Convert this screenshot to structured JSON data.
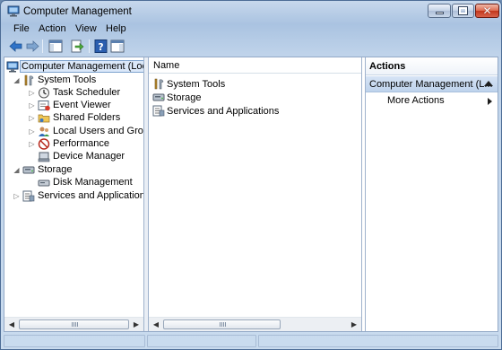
{
  "window": {
    "title": "Computer Management"
  },
  "menu": [
    "File",
    "Action",
    "View",
    "Help"
  ],
  "toolbar": {
    "buttons": [
      "back-icon",
      "forward-icon",
      "show-hide-console-tree-icon",
      "export-list-icon",
      "help-icon",
      "show-hide-action-pane-icon"
    ]
  },
  "tree": {
    "root": "Computer Management (Local",
    "items": [
      {
        "label": "System Tools",
        "icon": "system-tools-icon",
        "level": 1,
        "expander": "expanded"
      },
      {
        "label": "Task Scheduler",
        "icon": "task-scheduler-icon",
        "level": 2,
        "expander": "collapsed"
      },
      {
        "label": "Event Viewer",
        "icon": "event-viewer-icon",
        "level": 2,
        "expander": "collapsed"
      },
      {
        "label": "Shared Folders",
        "icon": "shared-folders-icon",
        "level": 2,
        "expander": "collapsed"
      },
      {
        "label": "Local Users and Groups",
        "icon": "local-users-icon",
        "level": 2,
        "expander": "collapsed"
      },
      {
        "label": "Performance",
        "icon": "performance-icon",
        "level": 2,
        "expander": "collapsed"
      },
      {
        "label": "Device Manager",
        "icon": "device-manager-icon",
        "level": 2,
        "expander": "none"
      },
      {
        "label": "Storage",
        "icon": "storage-icon",
        "level": 1,
        "expander": "expanded"
      },
      {
        "label": "Disk Management",
        "icon": "disk-management-icon",
        "level": 2,
        "expander": "none"
      },
      {
        "label": "Services and Applications",
        "icon": "services-icon",
        "level": 1,
        "expander": "collapsed"
      }
    ]
  },
  "list": {
    "column": "Name",
    "items": [
      "System Tools",
      "Storage",
      "Services and Applications"
    ]
  },
  "actions": {
    "header": "Actions",
    "group": "Computer Management (L...",
    "items": [
      "More Actions"
    ]
  },
  "colors": {
    "selection": "#dbe8f9",
    "window_frame": "#aac3e1",
    "action_group": "#bed3ec"
  }
}
